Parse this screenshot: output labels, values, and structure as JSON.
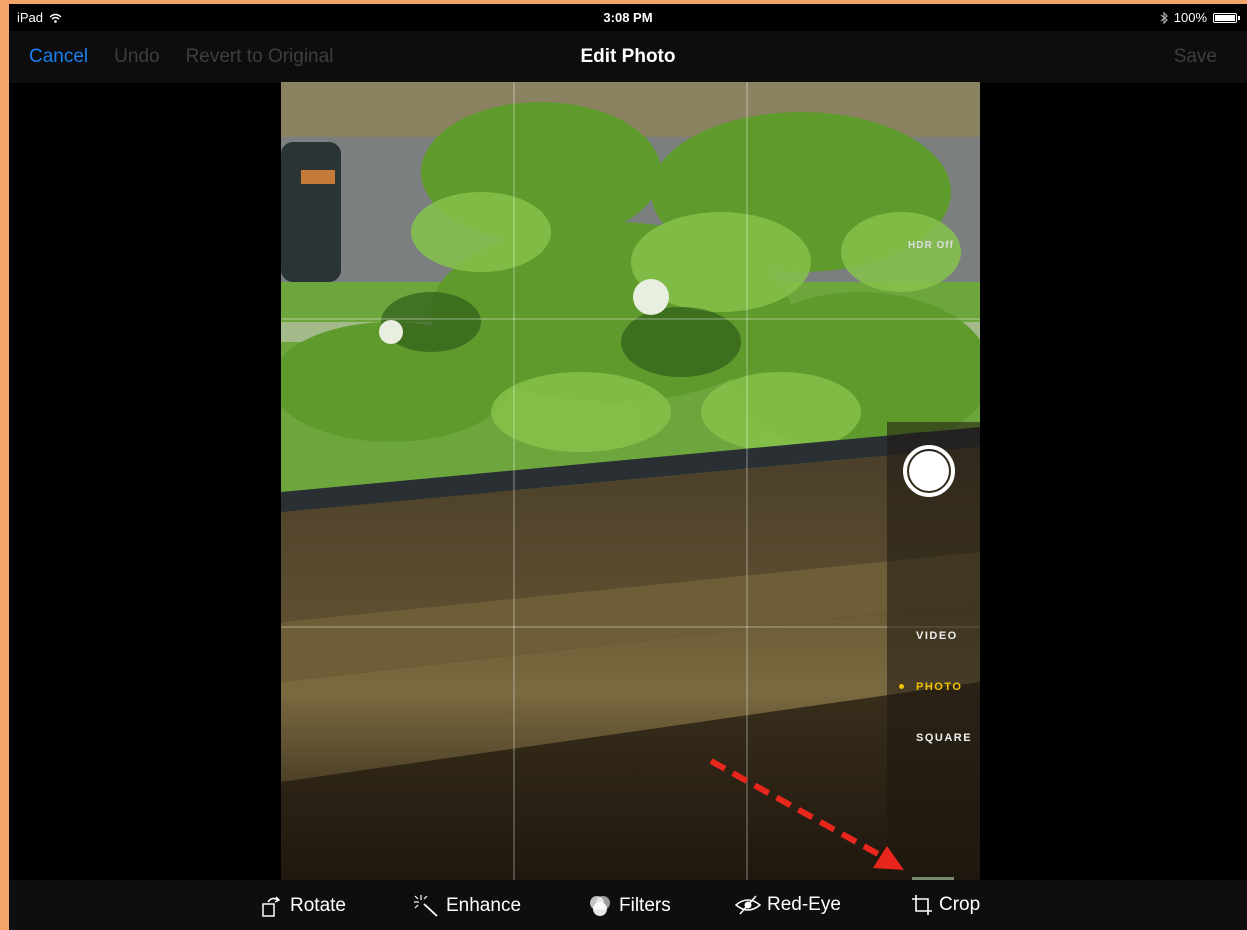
{
  "status_bar": {
    "device": "iPad",
    "time": "3:08 PM",
    "battery": "100%",
    "icons": [
      "wifi-icon",
      "bluetooth-icon",
      "battery-icon"
    ]
  },
  "nav": {
    "cancel": "Cancel",
    "undo": "Undo",
    "revert": "Revert to Original",
    "title": "Edit Photo",
    "save": "Save"
  },
  "camera": {
    "hdr": "HDR Off",
    "modes": [
      "VIDEO",
      "PHOTO",
      "SQUARE"
    ],
    "selected_mode": "PHOTO"
  },
  "toolbar": {
    "rotate": "Rotate",
    "enhance": "Enhance",
    "filters": "Filters",
    "redeye": "Red-Eye",
    "crop": "Crop"
  },
  "colors": {
    "accent": "#1a7ff0",
    "mode_highlight": "#f2c200",
    "annotation_arrow": "#e8261c",
    "border": "#f4a46a"
  }
}
